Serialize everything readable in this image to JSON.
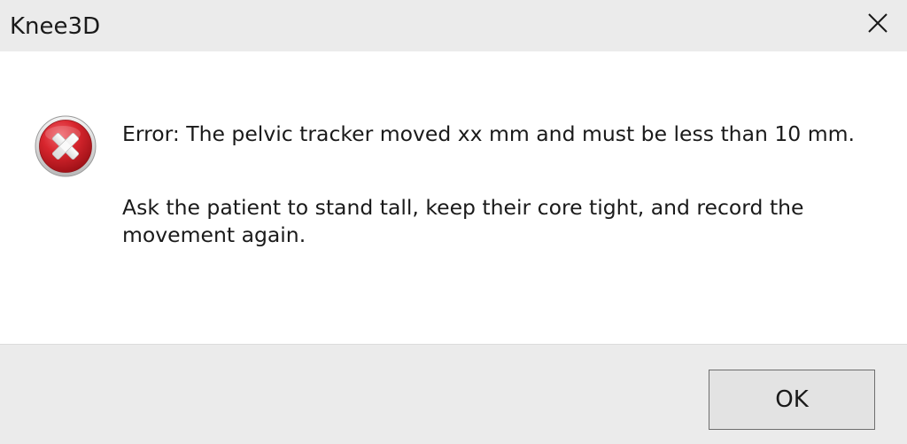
{
  "window": {
    "title": "Knee3D",
    "close_icon": "close-icon"
  },
  "message": {
    "icon": "error-icon",
    "line1": "Error: The pelvic tracker moved xx mm and must be less than 10 mm.",
    "line2": "Ask the patient to stand tall, keep their core tight, and record the movement again."
  },
  "buttons": {
    "ok_label": "OK"
  },
  "colors": {
    "titlebar_bg": "#ebebeb",
    "footer_bg": "#ebebeb",
    "error_red": "#d2262d"
  }
}
